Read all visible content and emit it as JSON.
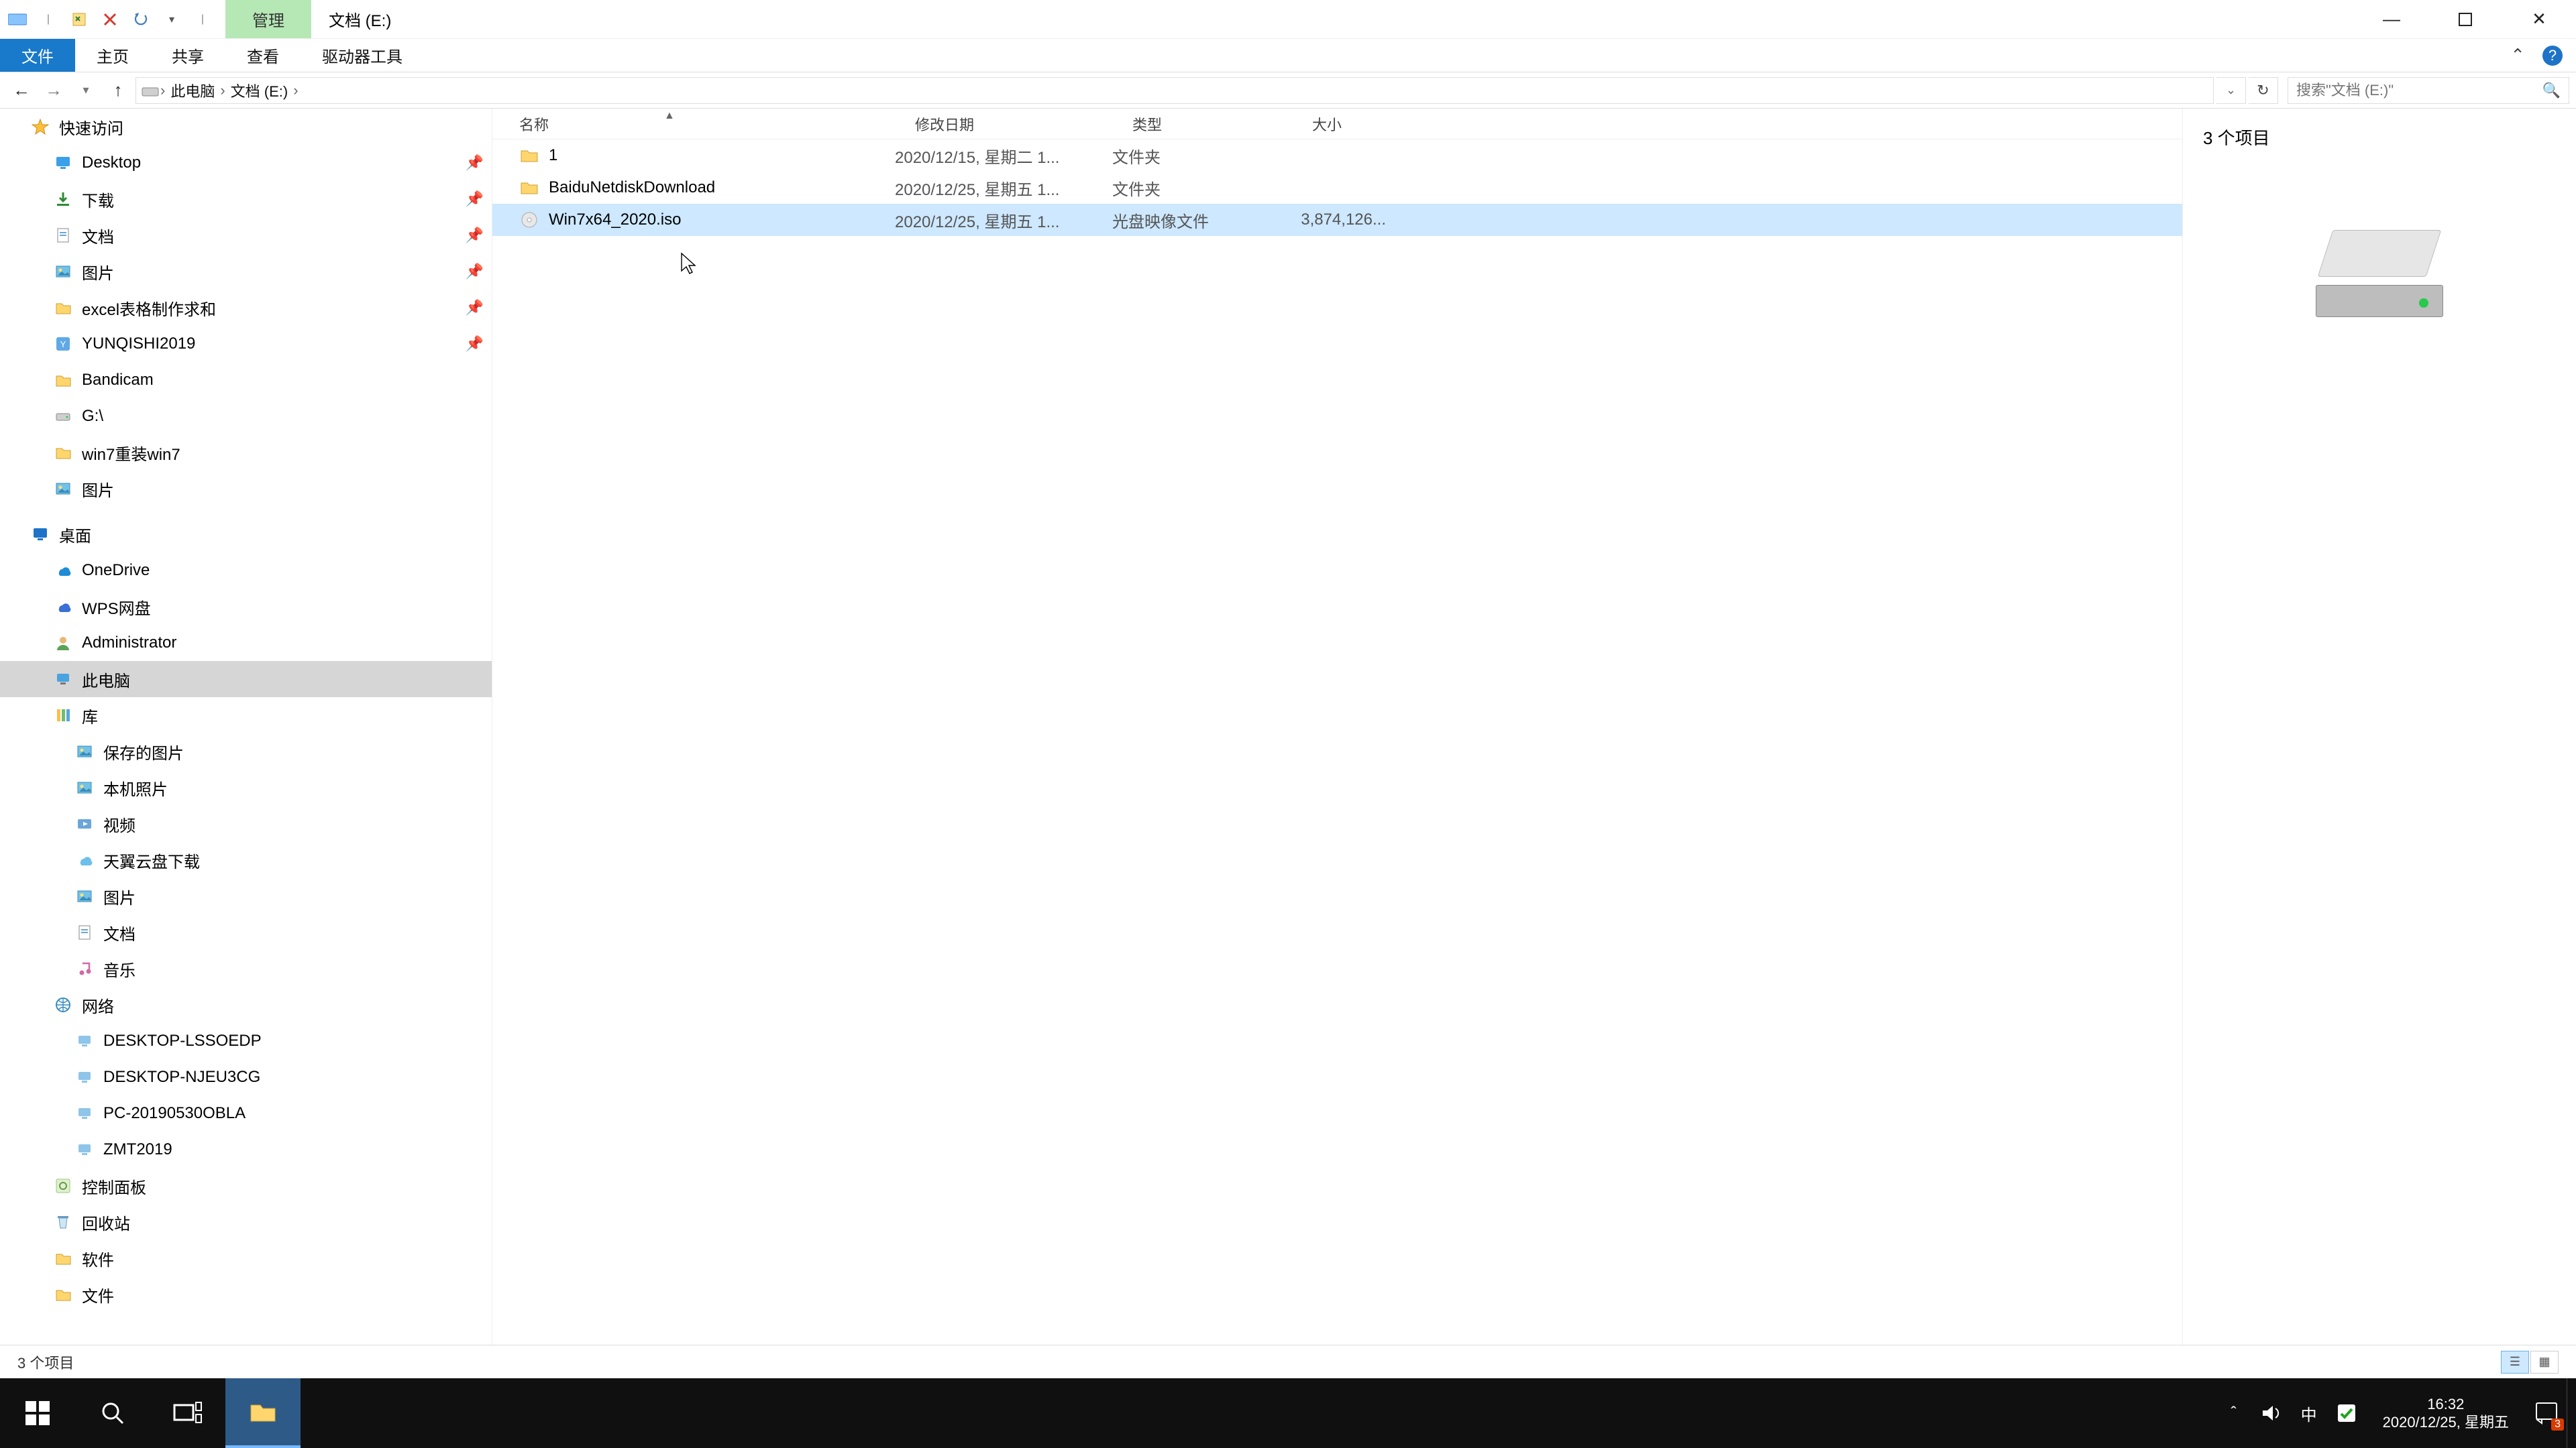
{
  "title": "文档 (E:)",
  "context_tab": "管理",
  "ribbon": {
    "file": "文件",
    "tabs": [
      "主页",
      "共享",
      "查看",
      "驱动器工具"
    ]
  },
  "breadcrumb": [
    "此电脑",
    "文档 (E:)"
  ],
  "search_placeholder": "搜索\"文档 (E:)\"",
  "columns": {
    "name": "名称",
    "date": "修改日期",
    "type": "类型",
    "size": "大小"
  },
  "rows": [
    {
      "icon": "folder",
      "name": "1",
      "date": "2020/12/15, 星期二 1...",
      "type": "文件夹",
      "size": "",
      "selected": false
    },
    {
      "icon": "folder",
      "name": "BaiduNetdiskDownload",
      "date": "2020/12/25, 星期五 1...",
      "type": "文件夹",
      "size": "",
      "selected": false
    },
    {
      "icon": "iso",
      "name": "Win7x64_2020.iso",
      "date": "2020/12/25, 星期五 1...",
      "type": "光盘映像文件",
      "size": "3,874,126...",
      "selected": true
    }
  ],
  "preview_summary": "3 个项目",
  "status_text": "3 个项目",
  "tree": [
    {
      "type": "item",
      "indent": 0,
      "icon": "star",
      "label": "快速访问",
      "pin": false
    },
    {
      "type": "item",
      "indent": 1,
      "icon": "desktop",
      "label": "Desktop",
      "pin": true
    },
    {
      "type": "item",
      "indent": 1,
      "icon": "download",
      "label": "下载",
      "pin": true
    },
    {
      "type": "item",
      "indent": 1,
      "icon": "doc",
      "label": "文档",
      "pin": true
    },
    {
      "type": "item",
      "indent": 1,
      "icon": "pics",
      "label": "图片",
      "pin": true
    },
    {
      "type": "item",
      "indent": 1,
      "icon": "folder",
      "label": "excel表格制作求和",
      "pin": true
    },
    {
      "type": "item",
      "indent": 1,
      "icon": "app",
      "label": "YUNQISHI2019",
      "pin": true
    },
    {
      "type": "item",
      "indent": 1,
      "icon": "folder",
      "label": "Bandicam",
      "pin": false
    },
    {
      "type": "item",
      "indent": 1,
      "icon": "drive",
      "label": "G:\\",
      "pin": false
    },
    {
      "type": "item",
      "indent": 1,
      "icon": "folder",
      "label": "win7重装win7",
      "pin": false
    },
    {
      "type": "item",
      "indent": 1,
      "icon": "pics",
      "label": "图片",
      "pin": false
    },
    {
      "type": "gap"
    },
    {
      "type": "item",
      "indent": 0,
      "icon": "desktop-root",
      "label": "桌面",
      "pin": false
    },
    {
      "type": "item",
      "indent": 1,
      "icon": "onedrive",
      "label": "OneDrive",
      "pin": false
    },
    {
      "type": "item",
      "indent": 1,
      "icon": "wps",
      "label": "WPS网盘",
      "pin": false
    },
    {
      "type": "item",
      "indent": 1,
      "icon": "user",
      "label": "Administrator",
      "pin": false
    },
    {
      "type": "item",
      "indent": 1,
      "icon": "pc",
      "label": "此电脑",
      "pin": false,
      "selected": true
    },
    {
      "type": "item",
      "indent": 1,
      "icon": "lib",
      "label": "库",
      "pin": false
    },
    {
      "type": "item",
      "indent": 2,
      "icon": "pics",
      "label": "保存的图片",
      "pin": false
    },
    {
      "type": "item",
      "indent": 2,
      "icon": "pics",
      "label": "本机照片",
      "pin": false
    },
    {
      "type": "item",
      "indent": 2,
      "icon": "video",
      "label": "视频",
      "pin": false
    },
    {
      "type": "item",
      "indent": 2,
      "icon": "cloud",
      "label": "天翼云盘下载",
      "pin": false
    },
    {
      "type": "item",
      "indent": 2,
      "icon": "pics",
      "label": "图片",
      "pin": false
    },
    {
      "type": "item",
      "indent": 2,
      "icon": "doc",
      "label": "文档",
      "pin": false
    },
    {
      "type": "item",
      "indent": 2,
      "icon": "music",
      "label": "音乐",
      "pin": false
    },
    {
      "type": "item",
      "indent": 1,
      "icon": "net",
      "label": "网络",
      "pin": false
    },
    {
      "type": "item",
      "indent": 2,
      "icon": "netpc",
      "label": "DESKTOP-LSSOEDP",
      "pin": false
    },
    {
      "type": "item",
      "indent": 2,
      "icon": "netpc",
      "label": "DESKTOP-NJEU3CG",
      "pin": false
    },
    {
      "type": "item",
      "indent": 2,
      "icon": "netpc",
      "label": "PC-20190530OBLA",
      "pin": false
    },
    {
      "type": "item",
      "indent": 2,
      "icon": "netpc",
      "label": "ZMT2019",
      "pin": false
    },
    {
      "type": "item",
      "indent": 1,
      "icon": "cpl",
      "label": "控制面板",
      "pin": false
    },
    {
      "type": "item",
      "indent": 1,
      "icon": "recycle",
      "label": "回收站",
      "pin": false
    },
    {
      "type": "item",
      "indent": 1,
      "icon": "folder",
      "label": "软件",
      "pin": false
    },
    {
      "type": "item",
      "indent": 1,
      "icon": "folder",
      "label": "文件",
      "pin": false
    }
  ],
  "tray": {
    "ime": "中",
    "time": "16:32",
    "date": "2020/12/25, 星期五",
    "notif_count": "3"
  }
}
